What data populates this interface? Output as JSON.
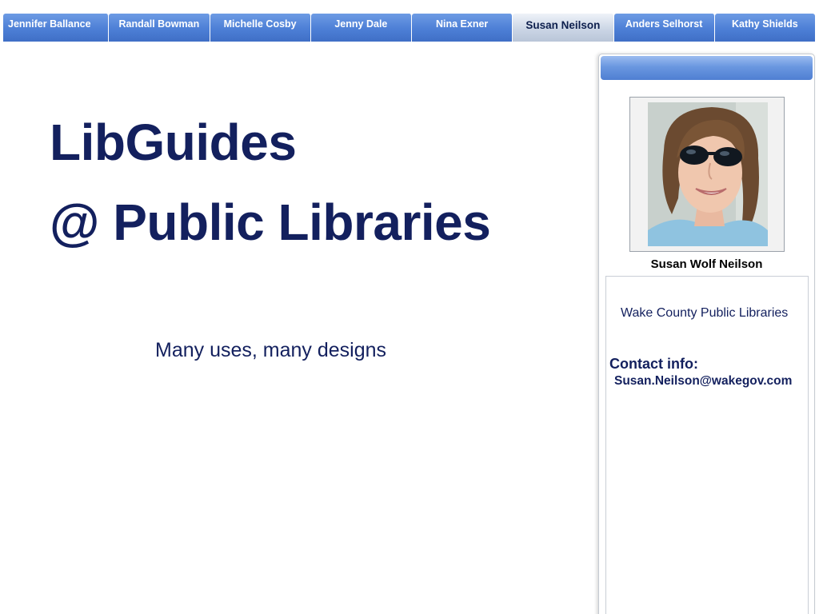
{
  "tabs": [
    {
      "label": "Jennifer Ballance",
      "active": false
    },
    {
      "label": "Randall Bowman",
      "active": false
    },
    {
      "label": "Michelle Cosby",
      "active": false
    },
    {
      "label": "Jenny Dale",
      "active": false
    },
    {
      "label": "Nina Exner",
      "active": false
    },
    {
      "label": "Susan Neilson",
      "active": true
    },
    {
      "label": "Anders Selhorst",
      "active": false
    },
    {
      "label": "Kathy Shields",
      "active": false
    }
  ],
  "main": {
    "title_line1": "LibGuides",
    "title_line2": "@ Public Libraries",
    "subtitle": "Many uses, many designs"
  },
  "profile": {
    "name": "Susan Wolf Neilson",
    "organization": "Wake County Public Libraries",
    "contact_label": "Contact info:",
    "email": "Susan.Neilson@wakegov.com"
  },
  "colors": {
    "title_text": "#13205e",
    "tab_blue": "#4d7fd6",
    "tab_active": "#c9d4e4"
  }
}
